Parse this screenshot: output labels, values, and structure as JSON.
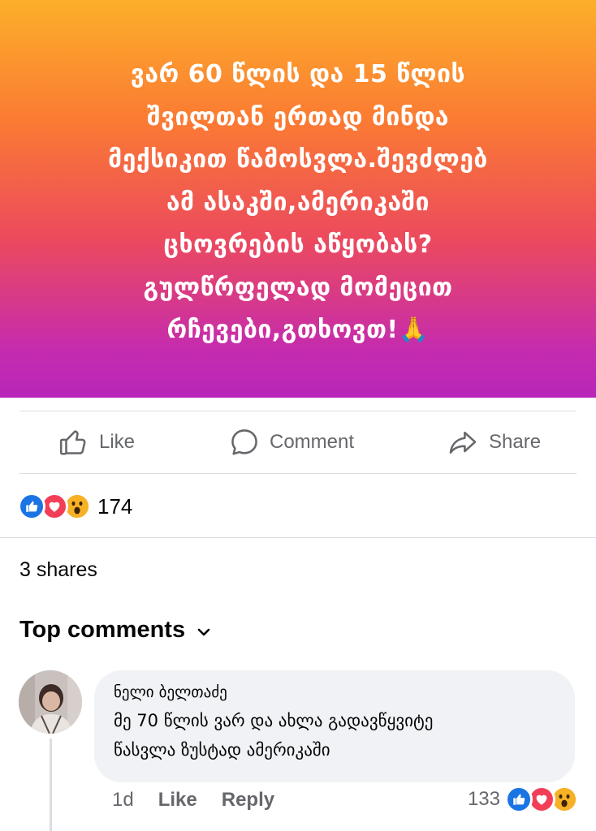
{
  "post": {
    "banner_text": "ვარ 60 წლის და 15 წლის\nშვილთან ერთად მინდა\nმექსიკით წამოსვლა.შევძლებ\nამ ასაკში,ამერიკაში\nცხოვრების აწყობას?\nგულწრფელად მომეცით\nრჩევები,გთხოვთ!🙏",
    "banner_colors": [
      "#fcb02a",
      "#fb7b33",
      "#ec4a5d",
      "#c52bae",
      "#b826b9"
    ]
  },
  "actions": {
    "like": "Like",
    "comment": "Comment",
    "share": "Share"
  },
  "reactions": {
    "icons": [
      "like-reaction-icon",
      "love-reaction-icon",
      "wow-reaction-icon"
    ],
    "count": "174"
  },
  "shares": "3 shares",
  "comments_header": {
    "label": "Top comments",
    "icon": "chevron-down-icon"
  },
  "comment": {
    "author": "ნელი ბელთაძე",
    "text": "მე 70 წლის ვარ და ახლა გადავწყვიტე\nწასვლა ზუსტად ამერიკაში",
    "time": "1d",
    "like": "Like",
    "reply": "Reply",
    "reaction_count": "133"
  },
  "colors": {
    "secondary_text": "#65676b",
    "bubble": "#f0f2f5",
    "like_blue": "#1b74e4",
    "love_red": "#f33e58",
    "wow_yellow": "#f7b125"
  }
}
